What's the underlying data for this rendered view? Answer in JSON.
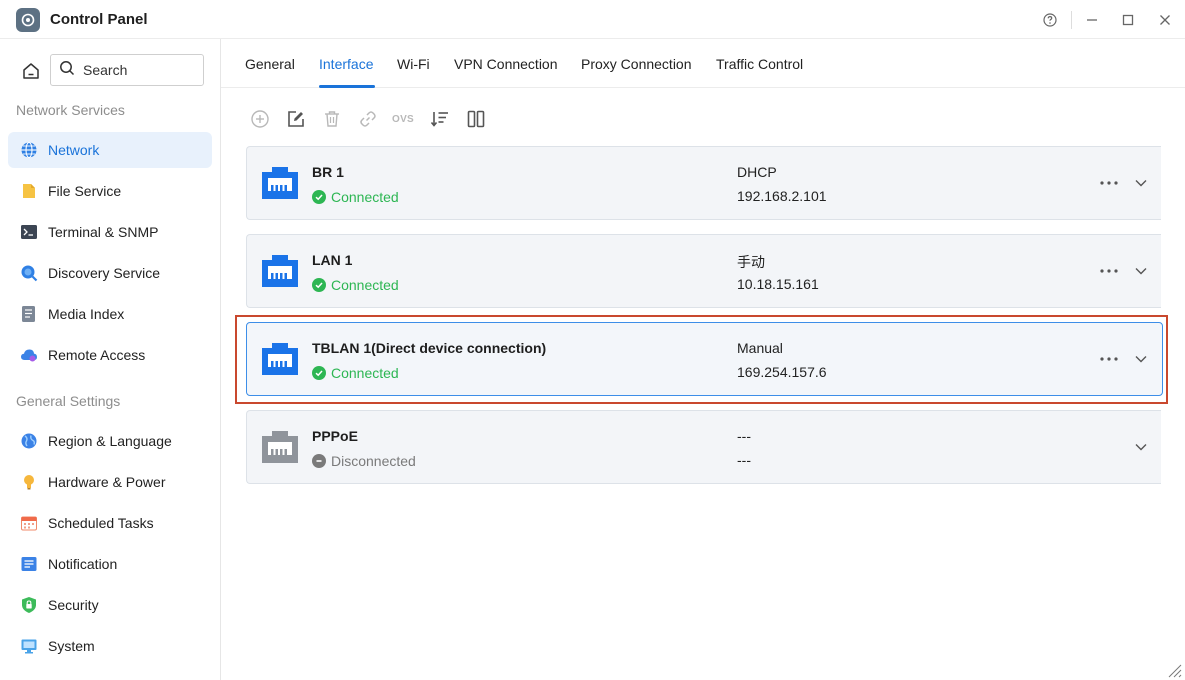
{
  "window": {
    "title": "Control Panel"
  },
  "sidebar": {
    "search_placeholder": "Search",
    "sections": [
      {
        "label": "Network Services",
        "items": [
          {
            "label": "Network",
            "icon": "globe-icon",
            "active": true
          },
          {
            "label": "File Service",
            "icon": "folder-icon"
          },
          {
            "label": "Terminal & SNMP",
            "icon": "terminal-icon"
          },
          {
            "label": "Discovery Service",
            "icon": "discovery-icon"
          },
          {
            "label": "Media Index",
            "icon": "media-index-icon"
          },
          {
            "label": "Remote Access",
            "icon": "cloud-icon"
          }
        ]
      },
      {
        "label": "General Settings",
        "items": [
          {
            "label": "Region & Language",
            "icon": "region-globe-icon"
          },
          {
            "label": "Hardware & Power",
            "icon": "lightbulb-icon"
          },
          {
            "label": "Scheduled Tasks",
            "icon": "calendar-icon"
          },
          {
            "label": "Notification",
            "icon": "notification-icon"
          },
          {
            "label": "Security",
            "icon": "shield-icon"
          },
          {
            "label": "System",
            "icon": "monitor-icon"
          }
        ]
      }
    ]
  },
  "tabs": [
    {
      "label": "General"
    },
    {
      "label": "Interface",
      "active": true
    },
    {
      "label": "Wi-Fi"
    },
    {
      "label": "VPN Connection"
    },
    {
      "label": "Proxy Connection"
    },
    {
      "label": "Traffic Control"
    }
  ],
  "toolbar": {
    "ovs_label": "OVS"
  },
  "interfaces": [
    {
      "name": "BR 1",
      "status": "Connected",
      "mode": "DHCP",
      "ip": "192.168.2.101",
      "connected": true
    },
    {
      "name": "LAN 1",
      "status": "Connected",
      "mode": "手动",
      "ip": "10.18.15.161",
      "connected": true
    },
    {
      "name": "TBLAN 1(Direct device connection)",
      "status": "Connected",
      "mode": "Manual",
      "ip": "169.254.157.6",
      "connected": true,
      "selected": true
    },
    {
      "name": "PPPoE",
      "status": "Disconnected",
      "mode": "---",
      "ip": "---",
      "connected": false
    }
  ],
  "colors": {
    "accent": "#1a73d9",
    "connected": "#2db653",
    "disconnected": "#7a7a7a",
    "highlight_frame": "#c9482e"
  }
}
